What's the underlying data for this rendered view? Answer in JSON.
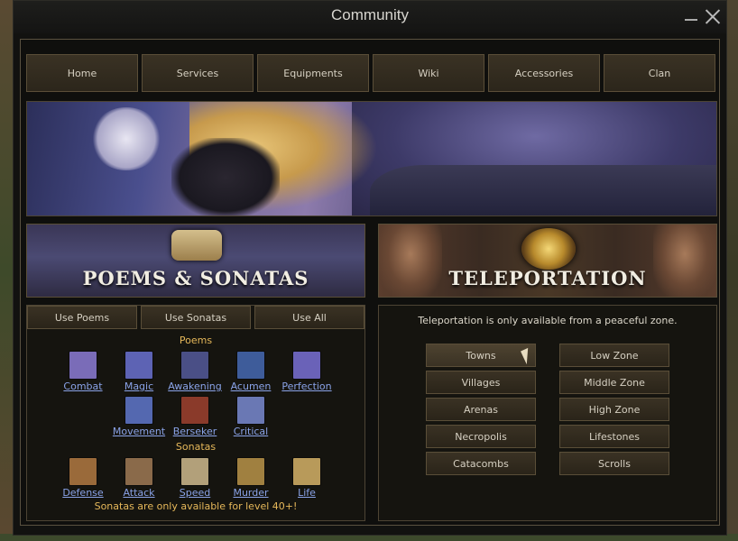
{
  "window": {
    "title": "Community"
  },
  "nav": [
    "Home",
    "Services",
    "Equipments",
    "Wiki",
    "Accessories",
    "Clan"
  ],
  "poems_section": {
    "title": "POEMS & SONATAS",
    "buttons": [
      "Use Poems",
      "Use Sonatas",
      "Use All"
    ],
    "poems_label": "Poems",
    "poems": [
      {
        "label": "Combat",
        "color": "#7a6cb8"
      },
      {
        "label": "Magic",
        "color": "#5d63b4"
      },
      {
        "label": "Awakening",
        "color": "#4a4f86"
      },
      {
        "label": "Acumen",
        "color": "#3e5c9a"
      },
      {
        "label": "Perfection",
        "color": "#6a62b8"
      },
      {
        "label": "Movement",
        "color": "#5468b0"
      },
      {
        "label": "Berseker",
        "color": "#8a3a2a"
      },
      {
        "label": "Critical",
        "color": "#6a78b4"
      }
    ],
    "sonatas_label": "Sonatas",
    "sonatas": [
      {
        "label": "Defense",
        "color": "#9a6a3a"
      },
      {
        "label": "Attack",
        "color": "#8a6a4a"
      },
      {
        "label": "Speed",
        "color": "#b2a07a"
      },
      {
        "label": "Murder",
        "color": "#a08040"
      },
      {
        "label": "Life",
        "color": "#b89a5a"
      }
    ],
    "notice": "Sonatas are only available for level 40+!"
  },
  "teleport_section": {
    "title": "TELEPORTATION",
    "info": "Teleportation is only available from a peaceful zone.",
    "left_buttons": [
      "Towns",
      "Villages",
      "Arenas",
      "Necropolis",
      "Catacombs"
    ],
    "right_buttons": [
      "Low Zone",
      "Middle Zone",
      "High Zone",
      "Lifestones",
      "Scrolls"
    ]
  }
}
